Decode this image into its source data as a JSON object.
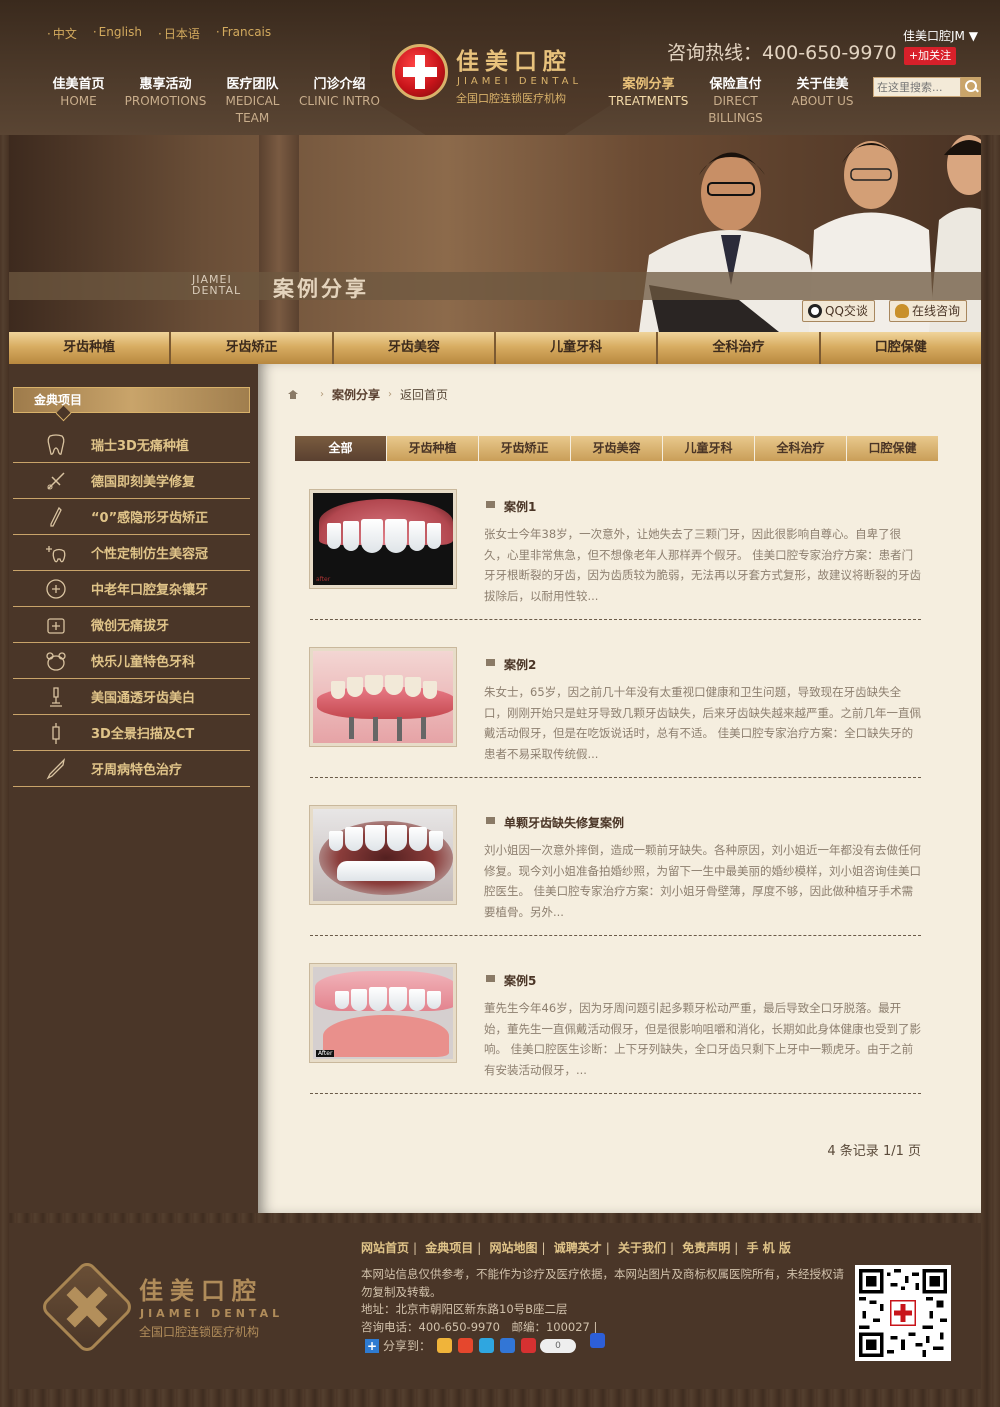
{
  "header": {
    "languages": [
      "中文",
      "English",
      "日本语",
      "Francais"
    ],
    "nav_left": [
      {
        "cn": "佳美首页",
        "en": "HOME"
      },
      {
        "cn": "惠享活动",
        "en": "PROMOTIONS"
      },
      {
        "cn": "医疗团队",
        "en": "MEDICAL TEAM"
      },
      {
        "cn": "门诊介绍",
        "en": "CLINIC INTRO"
      }
    ],
    "nav_right": [
      {
        "cn": "案例分享",
        "en": "TREATMENTS"
      },
      {
        "cn": "保险直付",
        "en": "DIRECT BILLINGS"
      },
      {
        "cn": "关于佳美",
        "en": "ABOUT US"
      }
    ],
    "logo_cn": "佳美口腔",
    "logo_en": "JIAMEI DENTAL",
    "logo_sub": "全国口腔连锁医疗机构",
    "hotline": "咨询热线：400-650-9970",
    "user_label": "佳美口腔JM",
    "follow_label": "+加关注",
    "search_placeholder": "在这里搜索..."
  },
  "banner": {
    "caption_en_1": "JIAMEI",
    "caption_en_2": "DENTAL",
    "caption_cn": "案例分享",
    "qq_label": "QQ交谈",
    "online_label": "在线咨询"
  },
  "categories": [
    "牙齿种植",
    "牙齿矫正",
    "牙齿美容",
    "儿童牙科",
    "全科治疗",
    "口腔保健"
  ],
  "sidebar": {
    "title": "金典项目",
    "items": [
      {
        "label": "瑞士3D无痛种植",
        "icon": "tooth-icon"
      },
      {
        "label": "德国即刻美学修复",
        "icon": "tools-icon"
      },
      {
        "label": "“0”感隐形牙齿矫正",
        "icon": "pen-icon"
      },
      {
        "label": "个性定制仿生美容冠",
        "icon": "sparkle-tooth-icon"
      },
      {
        "label": "中老年口腔复杂镶牙",
        "icon": "heart-plus-icon"
      },
      {
        "label": "微创无痛拔牙",
        "icon": "medical-box-icon"
      },
      {
        "label": "快乐儿童特色牙科",
        "icon": "bear-icon"
      },
      {
        "label": "美国通透牙齿美白",
        "icon": "microscope-icon"
      },
      {
        "label": "3D全景扫描及CT",
        "icon": "syringe-icon"
      },
      {
        "label": "牙周病特色治疗",
        "icon": "probe-icon"
      }
    ]
  },
  "main": {
    "breadcrumb": {
      "current": "案例分享",
      "back": "返回首页"
    },
    "tabs": [
      "全部",
      "牙齿种植",
      "牙齿矫正",
      "牙齿美容",
      "儿童牙科",
      "全科治疗",
      "口腔保健"
    ],
    "cases": [
      {
        "title": "案例1",
        "desc": "张女士今年38岁，一次意外，让她失去了三颗门牙，因此很影响自尊心。自卑了很久，心里非常焦急，但不想像老年人那样弄个假牙。 佳美口腔专家治疗方案：患者门牙牙根断裂的牙齿，因为齿质较为脆弱，无法再以牙套方式复形，故建议将断裂的牙齿拔除后，以耐用性较..."
      },
      {
        "title": "案例2",
        "desc": "朱女士，65岁，因之前几十年没有太重视口健康和卫生问题，导致现在牙齿缺失全口，刚刚开始只是蛀牙导致几颗牙齿缺失，后来牙齿缺失越来越严重。之前几年一直佩戴活动假牙，但是在吃饭说话时，总有不适。 佳美口腔专家治疗方案：全口缺失牙的患者不易采取传统假..."
      },
      {
        "title": "单颗牙齿缺失修复案例",
        "desc": "刘小姐因一次意外摔倒，造成一颗前牙缺失。各种原因，刘小姐近一年都没有去做任何修复。现今刘小姐准备拍婚纱照，为留下一生中最美丽的婚纱模样，刘小姐咨询佳美口腔医生。 佳美口腔专家治疗方案：刘小姐牙骨壁薄，厚度不够，因此做种植牙手术需要植骨。另外..."
      },
      {
        "title": "案例5",
        "desc": "董先生今年46岁，因为牙周问题引起多颗牙松动严重，最后导致全口牙脱落。最开始，董先生一直佩戴活动假牙，但是很影响咀嚼和消化，长期如此身体健康也受到了影响。 佳美口腔医生诊断：上下牙列缺失，全口牙齿只剩下上牙中一颗虎牙。由于之前有安装活动假牙，..."
      }
    ],
    "pager": "4 条记录 1/1 页"
  },
  "footer": {
    "links": [
      "网站首页",
      "金典项目",
      "网站地图",
      "诚聘英才",
      "关于我们",
      "免责声明",
      "手 机 版"
    ],
    "disclaimer": "本网站信息仅供参考，不能作为诊疗及医疗依据，本网站图片及商标权属医院所有，未经授权请勿复制及转载。",
    "address": "地址：北京市朝阳区新东路10号B座二层",
    "phone": "咨询电话：400-650-9970　邮编：100027 |",
    "share_label": "分享到：",
    "share_count": "0",
    "logo_cn": "佳美口腔",
    "logo_en": "JIAMEI DENTAL",
    "logo_sub": "全国口腔连锁医疗机构"
  }
}
